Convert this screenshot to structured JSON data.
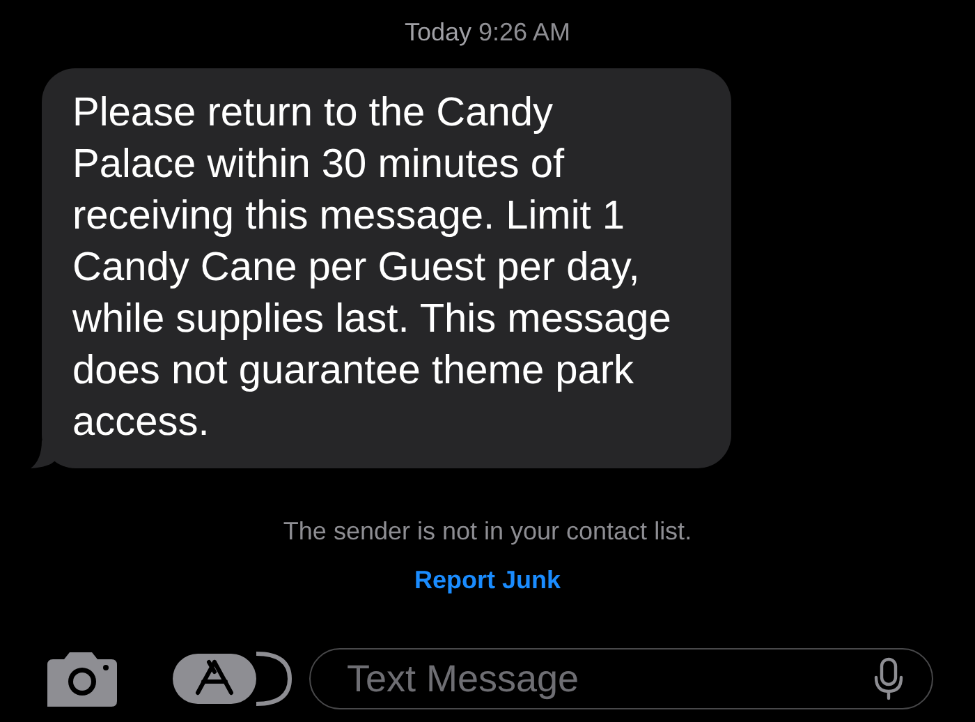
{
  "timestamp": {
    "day": "Today",
    "time": "9:26 AM"
  },
  "message": {
    "text": "Please return to the Candy Palace within 30 minutes of receiving this message. Limit 1 Candy Cane per Guest per day, while supplies last. This message does not guarantee theme park access."
  },
  "notice": "The sender is not in your contact list.",
  "report_link": "Report Junk",
  "composer": {
    "placeholder": "Text Message"
  }
}
